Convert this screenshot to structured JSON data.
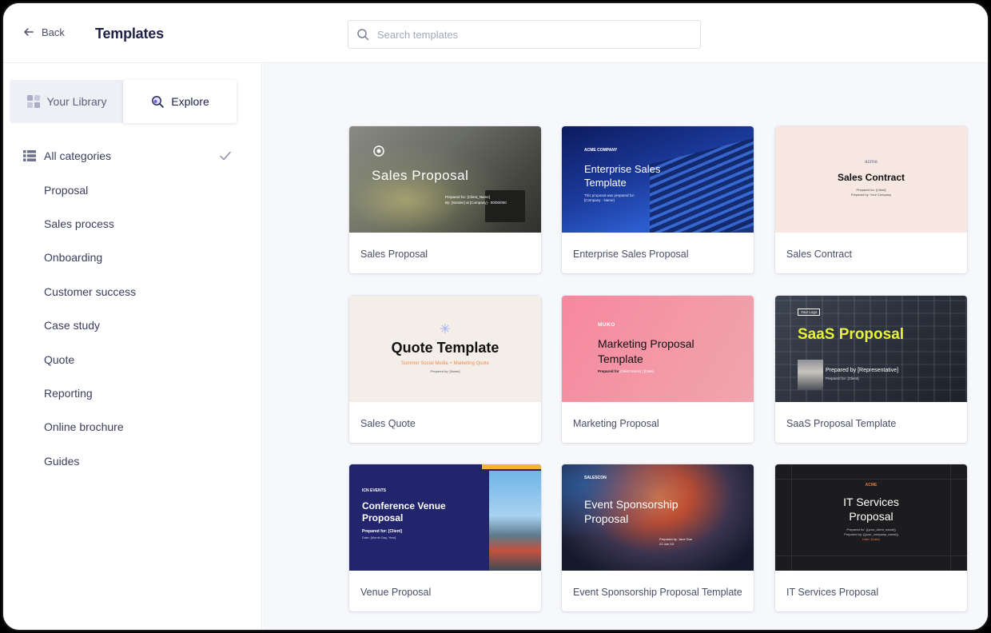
{
  "header": {
    "back_label": "Back",
    "title": "Templates",
    "search_placeholder": "Search templates"
  },
  "sidebar": {
    "tabs": [
      {
        "label": "Your Library",
        "icon": "library-icon",
        "active": false
      },
      {
        "label": "Explore",
        "icon": "explore-icon",
        "active": true
      }
    ],
    "categories": [
      {
        "label": "All categories",
        "selected": true
      },
      {
        "label": "Proposal"
      },
      {
        "label": "Sales process"
      },
      {
        "label": "Onboarding"
      },
      {
        "label": "Customer success"
      },
      {
        "label": "Case study"
      },
      {
        "label": "Quote"
      },
      {
        "label": "Reporting"
      },
      {
        "label": "Online brochure"
      },
      {
        "label": "Guides"
      }
    ]
  },
  "templates": [
    {
      "label": "Sales Proposal",
      "thumb_title": "Sales Proposal",
      "thumb_line1": "Prepared for: [Client_Name]",
      "thumb_line2": "By: [Sender] at [Company] · 00/00/000"
    },
    {
      "label": "Enterprise Sales Proposal",
      "thumb_brand": "ACME COMPANY",
      "thumb_title_1": "Enterprise Sales",
      "thumb_title_2": "Template",
      "thumb_line1": "This proposal was prepared for:",
      "thumb_line2": "[Company · Name]"
    },
    {
      "label": "Sales Contract",
      "thumb_brand": "acme",
      "thumb_title": "Sales Contract",
      "thumb_line1": "Prepared for: [Client]",
      "thumb_line2": "Prepared by: Your Company"
    },
    {
      "label": "Sales Quote",
      "thumb_title": "Quote Template",
      "thumb_subtitle": "Summer Social Media + Marketing Quote",
      "thumb_line1": "Prepared by: [Name]"
    },
    {
      "label": "Marketing Proposal",
      "thumb_brand": "MUKO",
      "thumb_title_1": "Marketing Proposal",
      "thumb_title_2": "Template",
      "thumb_line1": "Prepared for:",
      "thumb_line2": "[Client Name]  |  [Date]"
    },
    {
      "label": "SaaS Proposal Template",
      "thumb_logo": "Your Logo",
      "thumb_title": "SaaS Proposal",
      "thumb_line1": "Prepared by [Representative]",
      "thumb_line2": "Prepared for: [Client]"
    },
    {
      "label": "Venue Proposal",
      "thumb_brand": "ICN EVENTS",
      "thumb_title_1": "Conference Venue",
      "thumb_title_2": "Proposal",
      "thumb_line1": "Prepared for: [Client]",
      "thumb_line2": "Date: [Month Day, Year]"
    },
    {
      "label": "Event Sponsorship Proposal Template",
      "thumb_brand": "SALESCON",
      "thumb_title_1": "Event Sponsorship",
      "thumb_title_2": "Proposal",
      "thumb_line1": "Prepared by: Jane Doe",
      "thumb_line2": "22 Jan XX"
    },
    {
      "label": "IT Services Proposal",
      "thumb_brand": "ACME",
      "thumb_title_1": "IT Services",
      "thumb_title_2": "Proposal",
      "thumb_line1": "Prepared for: {{your_client_name}}",
      "thumb_line2": "Prepared by: {{your_company_name}}",
      "thumb_line3": "Date: {Date}"
    }
  ],
  "colors": {
    "accent": "#1e2147",
    "muko_pink": "#f38fa4",
    "saas_yellow": "#e8f23a",
    "venue_navy": "#22256b",
    "quote_orange": "#f08a4b"
  }
}
